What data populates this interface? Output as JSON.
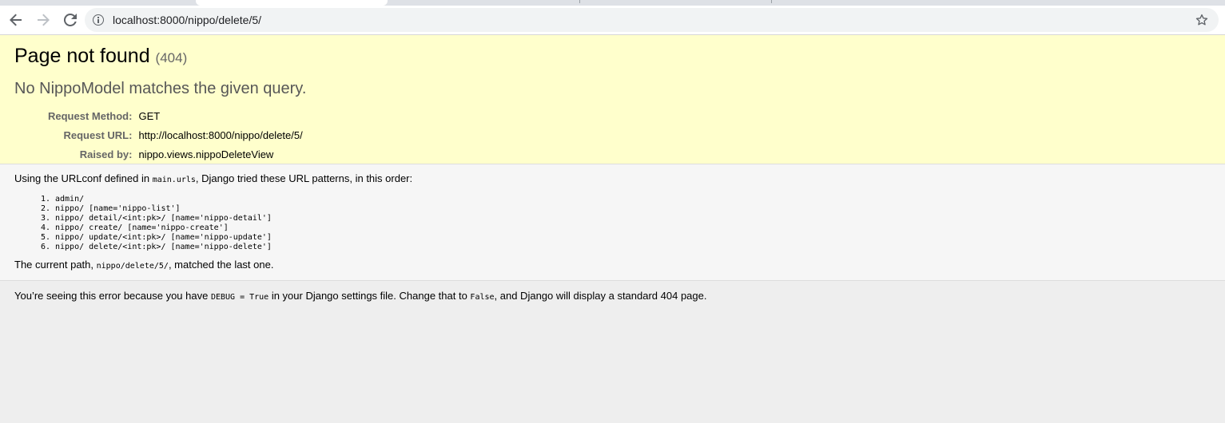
{
  "browser": {
    "url": "localhost:8000/nippo/delete/5/",
    "icons": {
      "back": "arrow-left-icon",
      "forward": "arrow-right-icon",
      "reload": "reload-icon",
      "site_info": "info-icon",
      "bookmark": "star-icon"
    }
  },
  "summary": {
    "title": "Page not found",
    "status_code": "(404)",
    "subtitle": "No NippoModel matches the given query.",
    "meta": [
      {
        "label": "Request Method:",
        "value": "GET"
      },
      {
        "label": "Request URL:",
        "value": "http://localhost:8000/nippo/delete/5/"
      },
      {
        "label": "Raised by:",
        "value": "nippo.views.nippoDeleteView"
      }
    ]
  },
  "info": {
    "intro_pre": "Using the URLconf defined in ",
    "intro_code": "main.urls",
    "intro_post": ", Django tried these URL patterns, in this order:",
    "patterns": [
      "admin/",
      "nippo/ [name='nippo-list']",
      "nippo/ detail/<int:pk>/ [name='nippo-detail']",
      "nippo/ create/ [name='nippo-create']",
      "nippo/ update/<int:pk>/ [name='nippo-update']",
      "nippo/ delete/<int:pk>/ [name='nippo-delete']"
    ],
    "current_pre": "The current path, ",
    "current_code": "nippo/delete/5/",
    "current_post": ", matched the last one."
  },
  "explanation": {
    "pre": "You’re seeing this error because you have ",
    "code1": "DEBUG = True",
    "mid": " in your Django settings file. Change that to ",
    "code2": "False",
    "post": ", and Django will display a standard 404 page."
  },
  "colors": {
    "summary_bg": "#ffffcc",
    "info_bg": "#f6f6f6",
    "page_bg": "#eeeeee"
  }
}
